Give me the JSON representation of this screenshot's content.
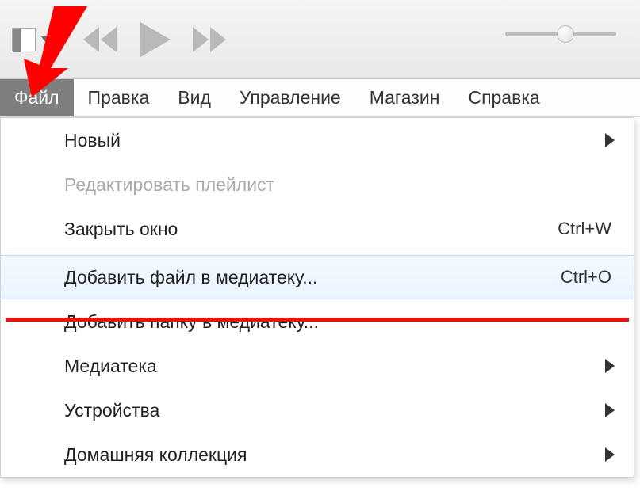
{
  "menubar": {
    "items": [
      "Файл",
      "Правка",
      "Вид",
      "Управление",
      "Магазин",
      "Справка"
    ],
    "activeIndex": 0
  },
  "dropdown": {
    "items": [
      {
        "label": "Новый",
        "shortcut": "",
        "submenu": true,
        "disabled": false,
        "highlighted": false
      },
      {
        "label": "Редактировать плейлист",
        "shortcut": "",
        "submenu": false,
        "disabled": true,
        "highlighted": false
      },
      {
        "label": "Закрыть окно",
        "shortcut": "Ctrl+W",
        "submenu": false,
        "disabled": false,
        "highlighted": false
      },
      {
        "separator": true
      },
      {
        "label": "Добавить файл в медиатеку...",
        "shortcut": "Ctrl+O",
        "submenu": false,
        "disabled": false,
        "highlighted": true
      },
      {
        "label": "Добавить папку в медиатеку...",
        "shortcut": "",
        "submenu": false,
        "disabled": false,
        "highlighted": false
      },
      {
        "label": "Медиатека",
        "shortcut": "",
        "submenu": true,
        "disabled": false,
        "highlighted": false
      },
      {
        "label": "Устройства",
        "shortcut": "",
        "submenu": true,
        "disabled": false,
        "highlighted": false
      },
      {
        "label": "Домашняя коллекция",
        "shortcut": "",
        "submenu": true,
        "disabled": false,
        "highlighted": false
      }
    ]
  },
  "icons": {
    "library": "library-icon",
    "dropdownArrow": "chevron-down-icon",
    "prev": "previous-track-icon",
    "play": "play-icon",
    "next": "next-track-icon",
    "submenuArrow": "chevron-right-icon"
  }
}
